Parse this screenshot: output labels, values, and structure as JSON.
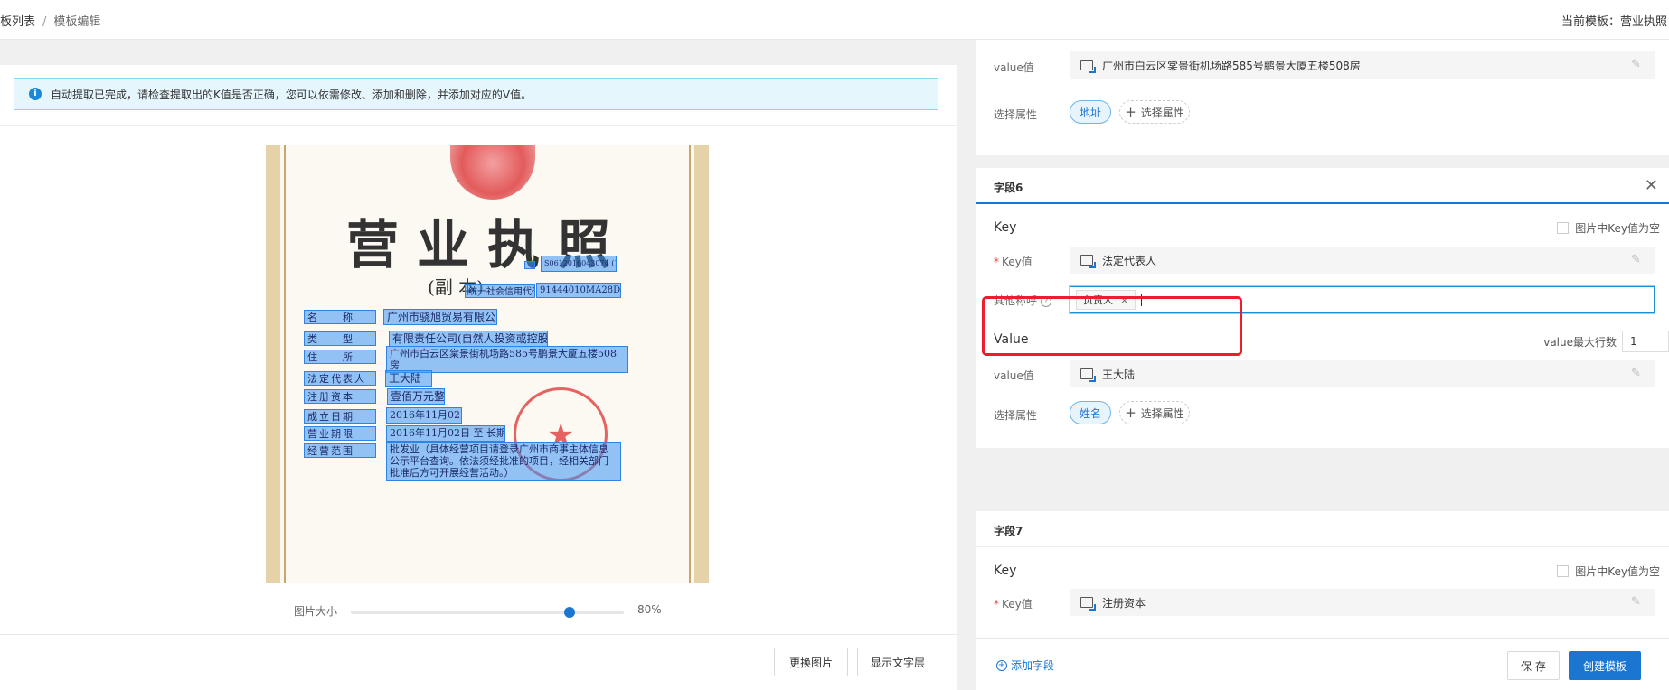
{
  "breadcrumb": {
    "item1": "板列表",
    "separator": "/",
    "item2": "模板编辑"
  },
  "current_template": "当前模板：营业执照",
  "notice": {
    "icon": "info-icon",
    "text": "自动提取已完成，请检查提取出的K值是否正确，您可以依需修改、添加和删除，并添加对应的V值。"
  },
  "document": {
    "title": "营业执照",
    "subtitle": "(副 本)",
    "serial": "S0612016043074 (1-1)",
    "credit_label": "统一社会信用代码",
    "credit_value": "91444010MA28DFG092",
    "keys": [
      "名　　称",
      "类　　型",
      "住　　所",
      "法定代表人",
      "注册资本",
      "成立日期",
      "营业期限",
      "经营范围"
    ],
    "values": [
      "广州市骁旭贸易有限公司",
      "有限责任公司(自然人投资或控股)",
      "广州市白云区棠景街机场路585号鹏景大厦五楼508房",
      "王大陆",
      "壹佰万元整",
      "2016年11月02日",
      "2016年11月02日 至 长期",
      "批发业（具体经营项目请登录广州市商事主体信息公示平台查询。依法须经批准的项目，经相关部门批准后方可开展经营活动。）"
    ]
  },
  "image_size": {
    "label": "图片大小",
    "value_text": "80%",
    "value": 0.8
  },
  "left_buttons": {
    "replace_image": "更换图片",
    "show_text_layer": "显示文字层"
  },
  "field5_partial": {
    "value_label": "value值",
    "value": "广州市白云区棠景街机场路585号鹏景大厦五楼508房",
    "attr_label": "选择属性",
    "attr_selected": "地址",
    "attr_add": "选择属性"
  },
  "field6": {
    "title": "字段6",
    "key_section": "Key",
    "key_empty_checkbox": "图片中Key值为空",
    "key_label": "Key值",
    "key_value": "法定代表人",
    "alias_label": "其他称呼",
    "alias_tags": [
      "负责人"
    ],
    "value_section": "Value",
    "max_rows_label": "value最大行数",
    "max_rows": "1",
    "value_label": "value值",
    "value": "王大陆",
    "attr_label": "选择属性",
    "attr_selected": "姓名",
    "attr_add": "选择属性"
  },
  "field7": {
    "title": "字段7",
    "key_section": "Key",
    "key_empty_checkbox": "图片中Key值为空",
    "key_label": "Key值",
    "key_value": "注册资本"
  },
  "footer": {
    "add_field": "添加字段",
    "save": "保 存",
    "create": "创建模板"
  },
  "colors": {
    "primary": "#1b76d2",
    "highlight": "#ef1c2c",
    "ocr_box": "#3c96f5"
  }
}
